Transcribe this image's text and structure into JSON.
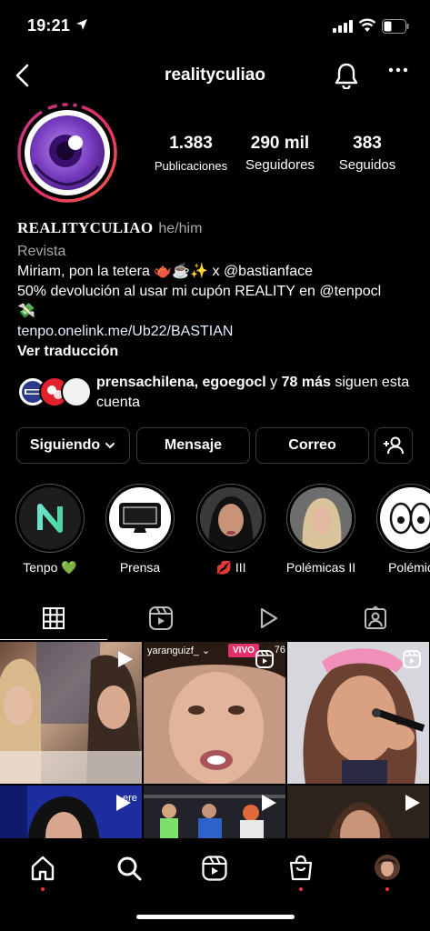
{
  "status_bar": {
    "time": "19:21"
  },
  "nav": {
    "title": "realityculiao"
  },
  "stats": {
    "posts_value": "1.383",
    "posts_label": "Publicaciones",
    "followers_value": "290 mil",
    "followers_label": "Seguidores",
    "following_value": "383",
    "following_label": "Seguidos"
  },
  "bio": {
    "name": "REALITYCULIAO",
    "pronouns": "he/him",
    "category": "Revista",
    "line1": "Miriam, pon la tetera 🫖☕️✨ x @bastianface",
    "line2": "50% devolución al usar mi cupón REALITY en @tenpocl",
    "line3": "💸",
    "link": "tenpo.onelink.me/Ub22/BASTIAN",
    "translate": "Ver traducción"
  },
  "followed_by": {
    "names": "prensachilena, egoegocl",
    "connector": " y ",
    "more": "78 más",
    "suffix": " siguen esta cuenta"
  },
  "buttons": {
    "following": "Siguiendo",
    "message": "Mensaje",
    "email": "Correo"
  },
  "highlights": [
    {
      "label": "Tenpo 💚"
    },
    {
      "label": "Prensa"
    },
    {
      "label": "💋 III"
    },
    {
      "label": "Polémicas II"
    },
    {
      "label": "Polémic"
    }
  ],
  "grid": {
    "post2_user": "yaranguizf_ ⌄",
    "post2_live": "VIVO",
    "post2_count": "76",
    "post4_text": "ere"
  },
  "colors": {
    "accent": "#e1306c",
    "link": "#e0f1ff",
    "notif": "#ff3040"
  }
}
